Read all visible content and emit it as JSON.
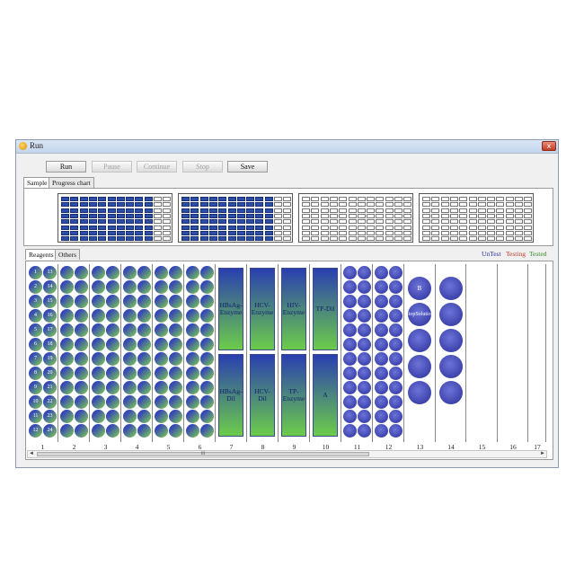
{
  "window": {
    "title": "Run",
    "close_glyph": "x"
  },
  "toolbar": {
    "run": "Run",
    "pause": "Pause",
    "continue": "Continue",
    "stop": "Stop",
    "save": "Save"
  },
  "top_tabs": [
    "Sample",
    "Progress chart"
  ],
  "plates": [
    {
      "state": "filled"
    },
    {
      "state": "filled"
    },
    {
      "state": "empty"
    },
    {
      "state": "empty"
    }
  ],
  "bottom_tabs": [
    "Reagents",
    "Others"
  ],
  "status": {
    "untest": "UnTest",
    "testing": "Testing",
    "tested": "Tested",
    "colors": {
      "untest": "#2a2fa0",
      "testing": "#c0392b",
      "tested": "#3a8a2a"
    }
  },
  "column_labels": [
    "1",
    "2",
    "3",
    "4",
    "5",
    "6",
    "7",
    "8",
    "9",
    "10",
    "11",
    "12",
    "13",
    "14",
    "15",
    "16",
    "17"
  ],
  "col1_numbers": [
    "1",
    "2",
    "3",
    "4",
    "5",
    "6",
    "7",
    "8",
    "9",
    "10",
    "11",
    "12"
  ],
  "col2_numbers": [
    "13",
    "14",
    "15",
    "16",
    "17",
    "18",
    "19",
    "20",
    "21",
    "22",
    "23",
    "24"
  ],
  "bottles": [
    {
      "top": "HBsAg-Enzyme",
      "bottom": "HBsAg-Dil"
    },
    {
      "top": "HCV-Enzyme",
      "bottom": "HCV-Dil"
    },
    {
      "top": "HIV-Enzyme",
      "bottom": "TP-Enzyme"
    },
    {
      "top": "TP-Dil",
      "bottom": "A"
    }
  ],
  "col13_labels": {
    "b": "B",
    "stop": "StopSolution"
  },
  "scroll_thumb": "III"
}
